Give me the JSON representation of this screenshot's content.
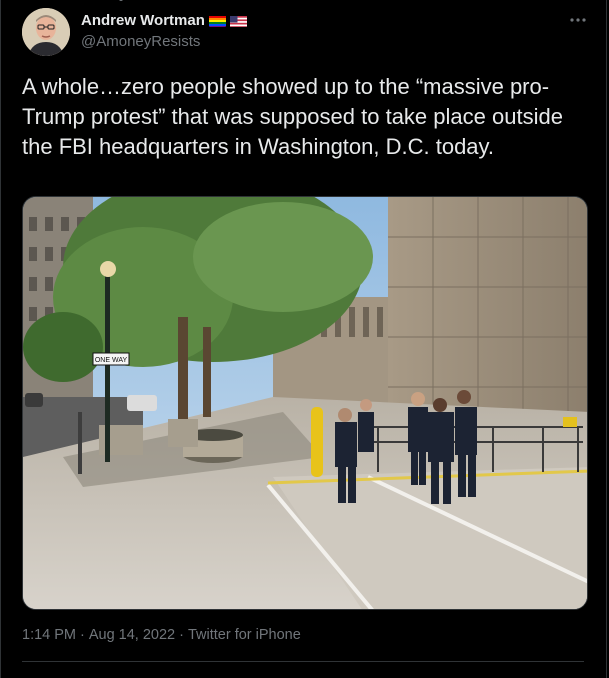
{
  "author": {
    "name": "Andrew Wortman",
    "handle": "@AmoneyResists",
    "flags": [
      "rainbow-flag-icon",
      "us-flag-icon"
    ]
  },
  "tweet": {
    "text": "A whole…zero people showed up to the “massive pro-Trump protest” that was supposed to take place outside the FBI headquarters in Washington, D.C. today.",
    "time": "1:14 PM",
    "separator": "·",
    "date": "Aug 14, 2022",
    "source": "Twitter for iPhone"
  },
  "media": {
    "street_sign": "ONE WAY"
  },
  "colors": {
    "background": "#000000",
    "text": "#e7e9ea",
    "muted": "#71767b",
    "border": "#2f3336"
  }
}
